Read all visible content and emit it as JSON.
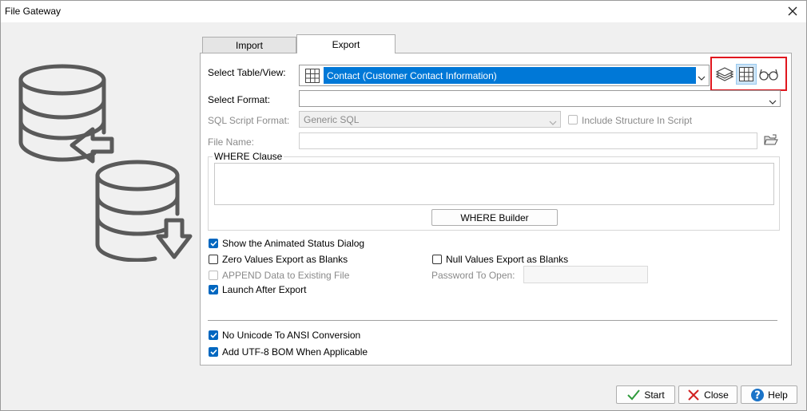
{
  "window": {
    "title": "File Gateway"
  },
  "tabs": [
    {
      "label": "Import"
    },
    {
      "label": "Export"
    }
  ],
  "form": {
    "table_label": "Select Table/View:",
    "table_value": "Contact  (Customer Contact Information)",
    "format_label": "Select Format:",
    "format_value": "",
    "sql_label": "SQL Script Format:",
    "sql_value": "Generic SQL",
    "include_structure": "Include Structure In Script",
    "filename_label": "File Name:",
    "filename_value": ""
  },
  "where": {
    "title": "WHERE Clause",
    "value": "",
    "builder_label": "WHERE Builder"
  },
  "options": {
    "animated": "Show the Animated Status Dialog",
    "zero": "Zero Values Export as Blanks",
    "null": "Null Values Export as Blanks",
    "append": "APPEND Data to Existing File",
    "password_label": "Password To Open:",
    "launch": "Launch After Export",
    "no_unicode": "No Unicode To ANSI Conversion",
    "utf8": "Add UTF-8 BOM When Applicable"
  },
  "checks": {
    "animated": true,
    "zero": false,
    "null": false,
    "append": false,
    "launch": true,
    "no_unicode": true,
    "utf8": true,
    "include_structure": false
  },
  "buttons": {
    "start": "Start",
    "close": "Close",
    "help": "Help"
  },
  "colors": {
    "selection": "#0078d7",
    "highlight_box": "#e0161e",
    "check": "#0067c0",
    "help_icon": "#1a73c8",
    "close_icon": "#d12020",
    "start_icon": "#2e9a3a"
  }
}
